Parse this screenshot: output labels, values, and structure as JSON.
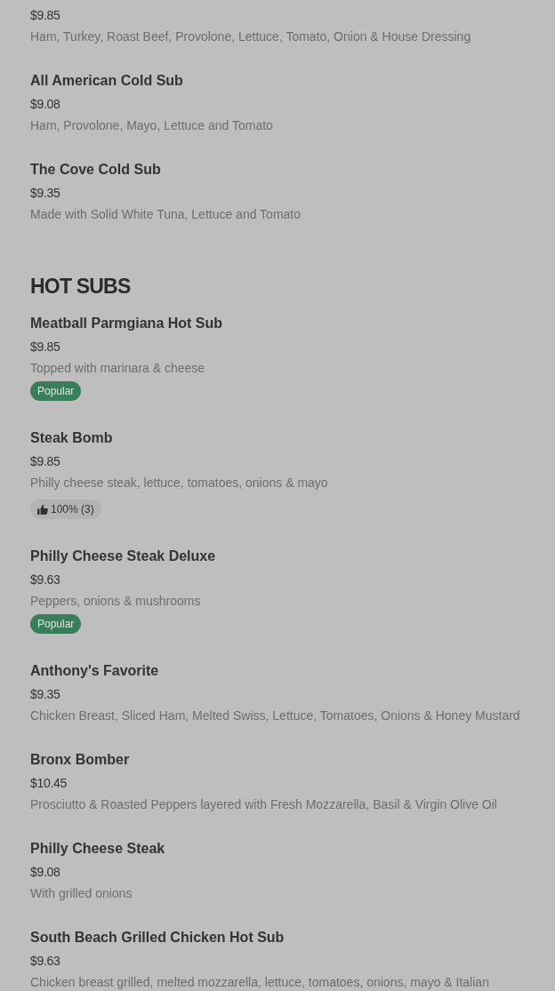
{
  "sections": [
    {
      "items": [
        {
          "price": "$9.85",
          "description": "Ham, Turkey, Roast Beef, Provolone, Lettuce, Tomato, Onion & House Dressing"
        },
        {
          "name": "All American Cold Sub",
          "price": "$9.08",
          "description": "Ham, Provolone, Mayo, Lettuce and Tomato"
        },
        {
          "name": "The Cove Cold Sub",
          "price": "$9.35",
          "description": "Made with Solid White Tuna, Lettuce and Tomato"
        }
      ]
    },
    {
      "title": "HOT SUBS",
      "items": [
        {
          "name": "Meatball Parmgiana Hot Sub",
          "price": "$9.85",
          "description": "Topped with marinara & cheese",
          "tags": [
            {
              "kind": "popular",
              "label": "Popular"
            }
          ]
        },
        {
          "name": "Steak Bomb",
          "price": "$9.85",
          "description": "Philly cheese steak, lettuce, tomatoes, onions & mayo",
          "tags": [
            {
              "kind": "rating",
              "label": "100% (3)"
            }
          ]
        },
        {
          "name": "Philly Cheese Steak Deluxe",
          "price": "$9.63",
          "description": "Peppers, onions & mushrooms",
          "tags": [
            {
              "kind": "popular",
              "label": "Popular"
            }
          ]
        },
        {
          "name": "Anthony's Favorite",
          "price": "$9.35",
          "description": "Chicken Breast, Sliced Ham, Melted Swiss, Lettuce, Tomatoes, Onions & Honey Mustard"
        },
        {
          "name": "Bronx Bomber",
          "price": "$10.45",
          "description": "Prosciutto & Roasted Peppers layered with Fresh Mozzarella, Basil & Virgin Olive Oil"
        },
        {
          "name": "Philly Cheese Steak",
          "price": "$9.08",
          "description": "With grilled onions"
        },
        {
          "name": "South Beach Grilled Chicken Hot Sub",
          "price": "$9.63",
          "description": "Chicken breast grilled, melted mozzarella, lettuce, tomatoes, onions, mayo & Italian"
        }
      ]
    }
  ]
}
